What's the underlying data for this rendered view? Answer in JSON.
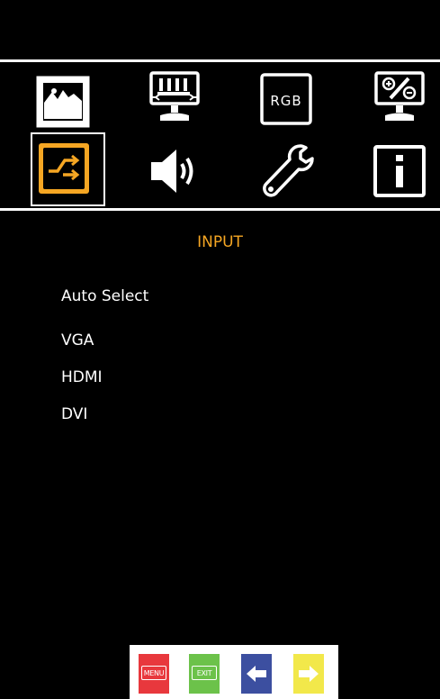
{
  "menu": {
    "title": "INPUT",
    "items": [
      "Auto Select",
      "VGA",
      "HDMI",
      "DVI"
    ]
  },
  "top_icons": [
    "picture-icon",
    "display-icon",
    "rgb-icon",
    "setup-icon",
    "input-icon",
    "audio-icon",
    "settings-icon",
    "information-icon"
  ],
  "icon_labels": {
    "rgb": "RGB"
  },
  "footer": {
    "menu_label": "MENU",
    "exit_label": "EXIT"
  },
  "colors": {
    "accent": "#f5a623",
    "menu_button": "#e8383d",
    "exit_button": "#6cc24a",
    "left_button": "#3c4fa0",
    "right_button": "#f2e84a"
  }
}
